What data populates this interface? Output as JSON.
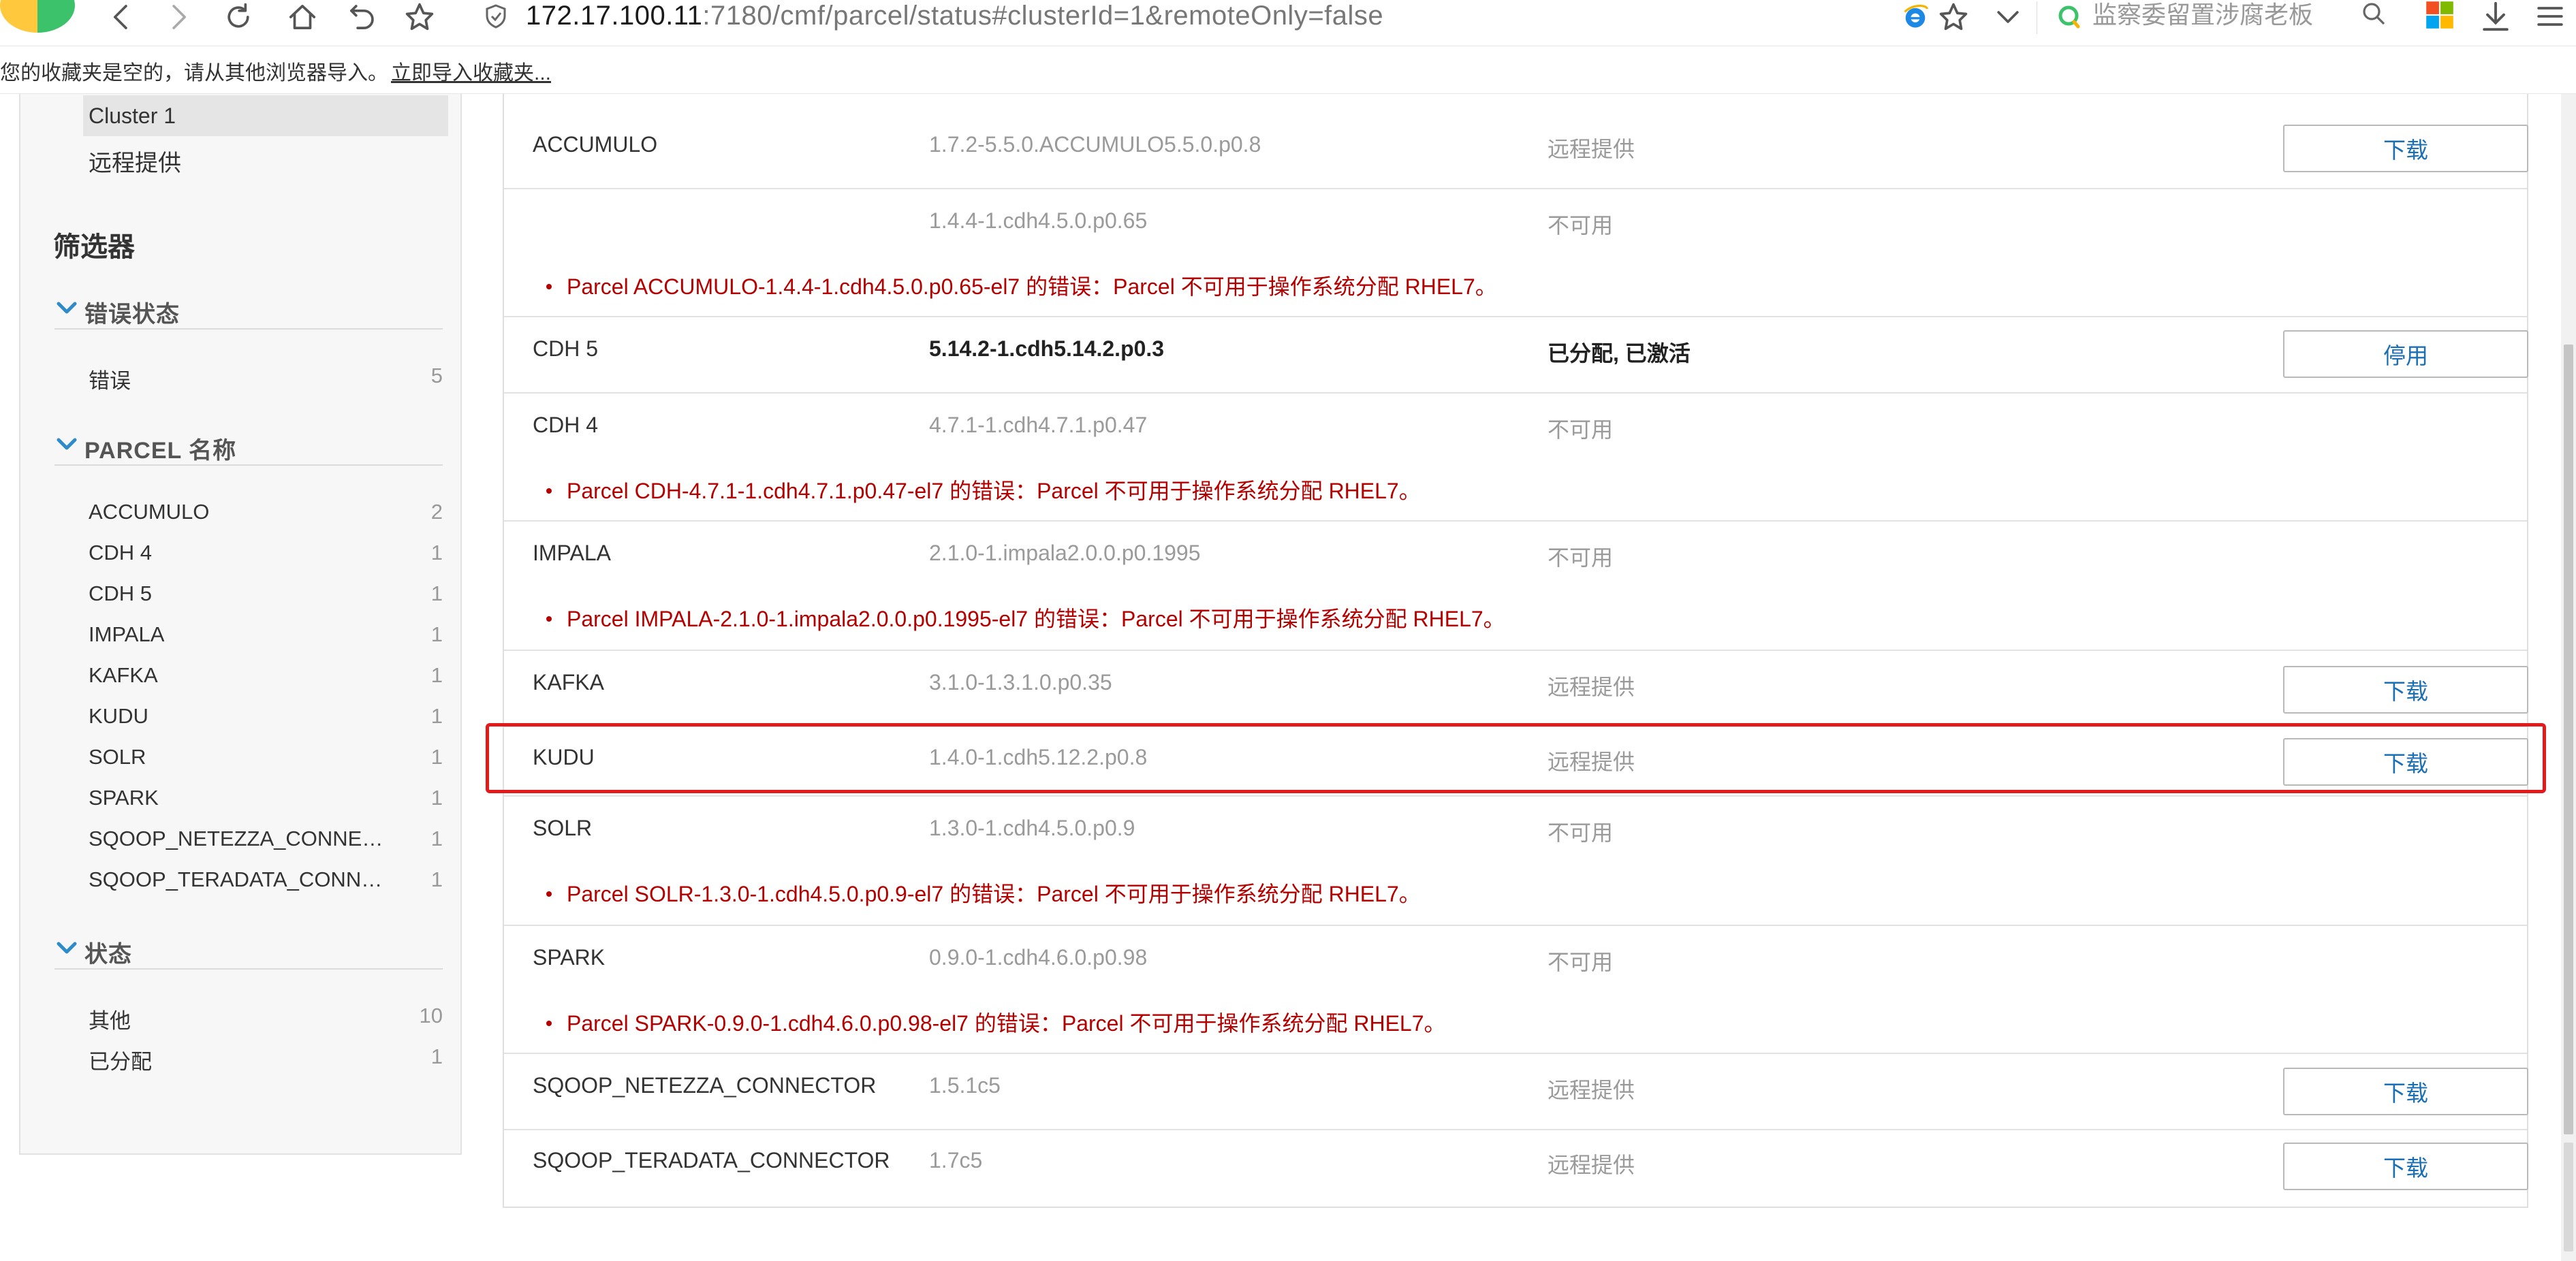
{
  "browser": {
    "url_host": "172.17.100.11",
    "url_rest": ":7180/cmf/parcel/status#clusterId=1&remoteOnly=false",
    "search_placeholder": "监察委留置涉腐老板",
    "bookmarks_message": "您的收藏夹是空的，请从其他浏览器导入。",
    "bookmarks_import_link": "立即导入收藏夹..."
  },
  "sidebar": {
    "cluster_label": "Cluster 1",
    "remote_label": "远程提供",
    "filter_title": "筛选器",
    "sections": [
      {
        "title": "错误状态",
        "items": [
          {
            "label": "错误",
            "count": "5"
          }
        ]
      },
      {
        "title": "PARCEL 名称",
        "items": [
          {
            "label": "ACCUMULO",
            "count": "2"
          },
          {
            "label": "CDH 4",
            "count": "1"
          },
          {
            "label": "CDH 5",
            "count": "1"
          },
          {
            "label": "IMPALA",
            "count": "1"
          },
          {
            "label": "KAFKA",
            "count": "1"
          },
          {
            "label": "KUDU",
            "count": "1"
          },
          {
            "label": "SOLR",
            "count": "1"
          },
          {
            "label": "SPARK",
            "count": "1"
          },
          {
            "label": "SQOOP_NETEZZA_CONNECTOR",
            "count": "1"
          },
          {
            "label": "SQOOP_TERADATA_CONNECTOR",
            "count": "1"
          }
        ]
      },
      {
        "title": "状态",
        "items": [
          {
            "label": "其他",
            "count": "10"
          },
          {
            "label": "已分配",
            "count": "1"
          }
        ]
      }
    ]
  },
  "parcels": [
    {
      "name": "ACCUMULO",
      "version": "1.7.2-5.5.0.ACCUMULO5.5.0.p0.8",
      "status": "远程提供",
      "action": "下载"
    },
    {
      "name": "",
      "version": "1.4.4-1.cdh4.5.0.p0.65",
      "status": "不可用",
      "error": "Parcel ACCUMULO-1.4.4-1.cdh4.5.0.p0.65-el7 的错误：Parcel 不可用于操作系统分配 RHEL7。"
    },
    {
      "name": "CDH 5",
      "version": "5.14.2-1.cdh5.14.2.p0.3",
      "status": "已分配, 已激活",
      "action": "停用"
    },
    {
      "name": "CDH 4",
      "version": "4.7.1-1.cdh4.7.1.p0.47",
      "status": "不可用",
      "error": "Parcel CDH-4.7.1-1.cdh4.7.1.p0.47-el7 的错误：Parcel 不可用于操作系统分配 RHEL7。"
    },
    {
      "name": "IMPALA",
      "version": "2.1.0-1.impala2.0.0.p0.1995",
      "status": "不可用",
      "error": "Parcel IMPALA-2.1.0-1.impala2.0.0.p0.1995-el7 的错误：Parcel 不可用于操作系统分配 RHEL7。"
    },
    {
      "name": "KAFKA",
      "version": "3.1.0-1.3.1.0.p0.35",
      "status": "远程提供",
      "action": "下载"
    },
    {
      "name": "KUDU",
      "version": "1.4.0-1.cdh5.12.2.p0.8",
      "status": "远程提供",
      "action": "下载"
    },
    {
      "name": "SOLR",
      "version": "1.3.0-1.cdh4.5.0.p0.9",
      "status": "不可用",
      "error": "Parcel SOLR-1.3.0-1.cdh4.5.0.p0.9-el7 的错误：Parcel 不可用于操作系统分配 RHEL7。"
    },
    {
      "name": "SPARK",
      "version": "0.9.0-1.cdh4.6.0.p0.98",
      "status": "不可用",
      "error": "Parcel SPARK-0.9.0-1.cdh4.6.0.p0.98-el7 的错误：Parcel 不可用于操作系统分配 RHEL7。"
    },
    {
      "name": "SQOOP_NETEZZA_CONNECTOR",
      "version": "1.5.1c5",
      "status": "远程提供",
      "action": "下载"
    },
    {
      "name": "SQOOP_TERADATA_CONNECTOR",
      "version": "1.7c5",
      "status": "远程提供",
      "action": "下载"
    }
  ]
}
